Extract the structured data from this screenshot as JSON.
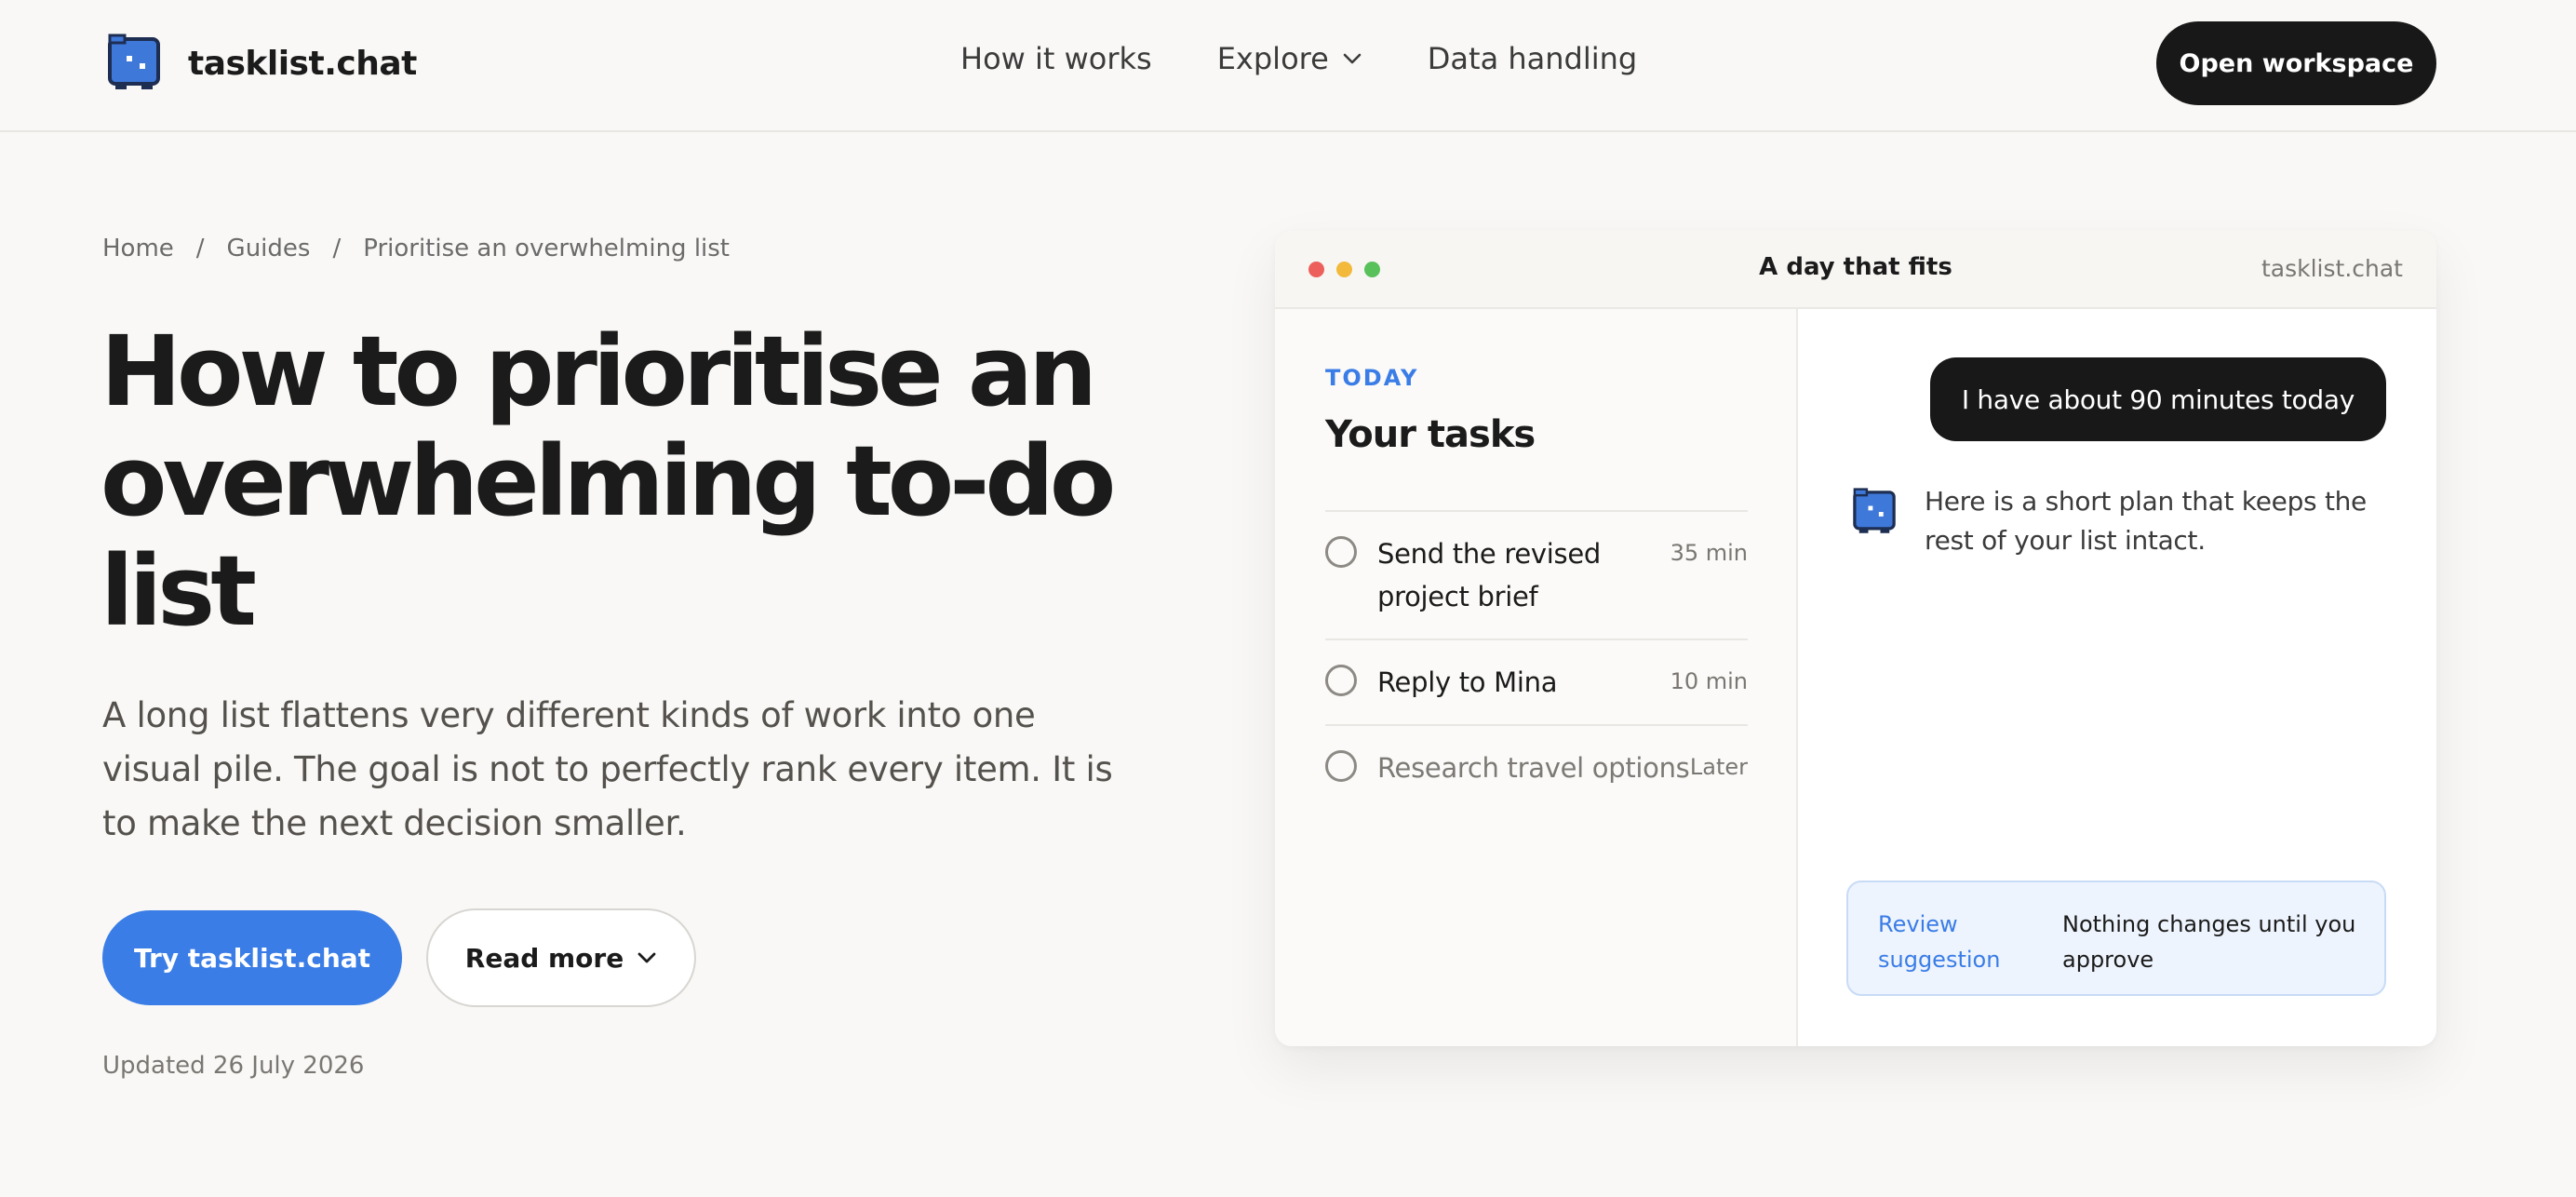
{
  "header": {
    "brand_name": "tasklist.chat",
    "nav": [
      {
        "label": "How it works",
        "has_dropdown": false
      },
      {
        "label": "Explore",
        "has_dropdown": true
      },
      {
        "label": "Data handling",
        "has_dropdown": false
      }
    ],
    "cta_label": "Open workspace"
  },
  "breadcrumb": {
    "items": [
      "Home",
      "Guides",
      "Prioritise an overwhelming list"
    ],
    "separator": "/"
  },
  "hero": {
    "title": "How to prioritise an overwhelming to-do list",
    "lede": "A long list flattens very different kinds of work into one visual pile. The goal is not to perfectly rank every item. It is to make the next decision smaller.",
    "primary_button": "Try tasklist.chat",
    "secondary_button": "Read more",
    "updated": "Updated 26 July 2026"
  },
  "preview": {
    "window_title": "A day that fits",
    "window_host": "tasklist.chat",
    "tasks_pane": {
      "eyebrow": "TODAY",
      "heading": "Your tasks",
      "tasks": [
        {
          "name": "Send the revised project brief",
          "time": "35 min",
          "checked": false
        },
        {
          "name": "Reply to Mina",
          "time": "10 min",
          "checked": false
        },
        {
          "name": "Research travel options",
          "time": "Later",
          "checked": false
        }
      ]
    },
    "chat_pane": {
      "user_message": "I have about 90 minutes today",
      "assistant_message": "Here is a short plan that keeps the rest of your list intact.",
      "suggestion_link": "Review suggestion",
      "suggestion_text": "Nothing changes until you approve"
    }
  },
  "colors": {
    "accent": "#3a7de6",
    "dark": "#181818",
    "background": "#f9f8f6",
    "suggestion_bg": "#eef4fd"
  },
  "icons": {
    "brand": "robot-logo-icon",
    "dropdown": "chevron-down-icon",
    "window_controls": [
      "close-dot-icon",
      "minimize-dot-icon",
      "maximize-dot-icon"
    ],
    "task_check": "circle-checkbox-icon",
    "assistant": "robot-avatar-icon"
  }
}
